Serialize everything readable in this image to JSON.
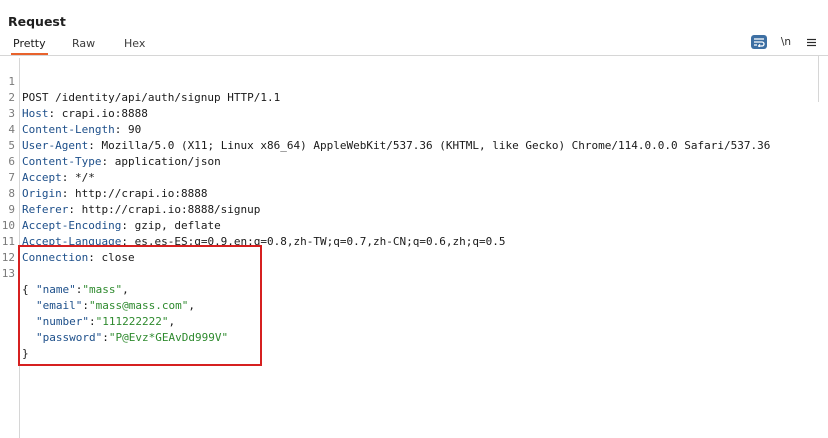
{
  "panel": {
    "title": "Request"
  },
  "tabs": [
    {
      "label": "Pretty"
    },
    {
      "label": "Raw"
    },
    {
      "label": "Hex"
    }
  ],
  "toolbar": {
    "newline_label": "\\n",
    "menu_label": "≡"
  },
  "request_line": {
    "ln": "1",
    "text": "POST /identity/api/auth/signup HTTP/1.1"
  },
  "headers": [
    {
      "ln": "2",
      "name": "Host",
      "value": "crapi.io:8888"
    },
    {
      "ln": "3",
      "name": "Content-Length",
      "value": "90"
    },
    {
      "ln": "4",
      "name": "User-Agent",
      "value": "Mozilla/5.0 (X11; Linux x86_64) AppleWebKit/537.36 (KHTML, like Gecko) Chrome/114.0.0.0 Safari/537.36"
    },
    {
      "ln": "5",
      "name": "Content-Type",
      "value": "application/json"
    },
    {
      "ln": "6",
      "name": "Accept",
      "value": "*/*"
    },
    {
      "ln": "7",
      "name": "Origin",
      "value": "http://crapi.io:8888"
    },
    {
      "ln": "8",
      "name": "Referer",
      "value": "http://crapi.io:8888/signup"
    },
    {
      "ln": "9",
      "name": "Accept-Encoding",
      "value": "gzip, deflate"
    },
    {
      "ln": "10",
      "name": "Accept-Language",
      "value": "es,es-ES;q=0.9,en;q=0.8,zh-TW;q=0.7,zh-CN;q=0.6,zh;q=0.5"
    },
    {
      "ln": "11",
      "name": "Connection",
      "value": "close"
    }
  ],
  "blank_line": {
    "ln": "12"
  },
  "body": {
    "ln": "13",
    "open": "{",
    "close": "}",
    "fields": [
      {
        "key": "\"name\"",
        "value": "\"mass\"",
        "sep": ","
      },
      {
        "key": "\"email\"",
        "value": "\"mass@mass.com\"",
        "sep": ","
      },
      {
        "key": "\"number\"",
        "value": "\"111222222\"",
        "sep": ","
      },
      {
        "key": "\"password\"",
        "value": "\"P@Evz*GEAvDd999V\"",
        "sep": ""
      }
    ]
  },
  "colors": {
    "accent": "#e8622c",
    "header_key": "#1d4f8a",
    "json_string": "#2e8a2e",
    "highlight": "#d62020"
  }
}
